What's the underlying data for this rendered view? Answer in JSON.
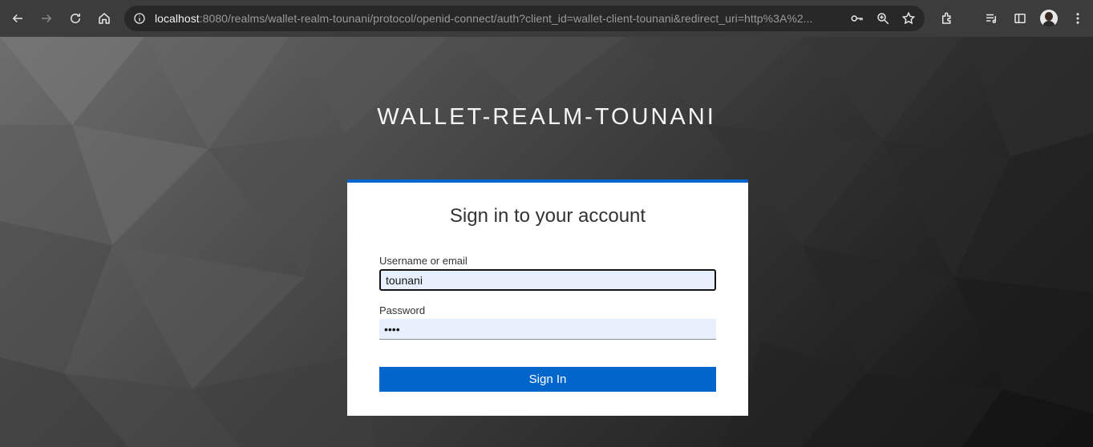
{
  "browser": {
    "url_host": "localhost",
    "url_rest": ":8080/realms/wallet-realm-tounani/protocol/openid-connect/auth?client_id=wallet-client-tounani&redirect_uri=http%3A%2..."
  },
  "realm": {
    "title": "WALLET-REALM-TOUNANI"
  },
  "login": {
    "heading": "Sign in to your account",
    "username_label": "Username or email",
    "username_value": "tounani",
    "password_label": "Password",
    "password_value": "••••",
    "submit_label": "Sign In"
  },
  "colors": {
    "accent": "#0066cc",
    "input_bg": "#e8f0fe"
  }
}
